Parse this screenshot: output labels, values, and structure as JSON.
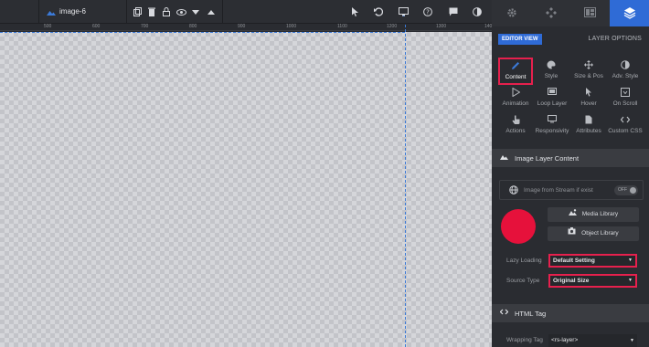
{
  "toolbar": {
    "layer_name": "image-6",
    "ruler_ticks": [
      "500",
      "600",
      "700",
      "800",
      "900",
      "1000",
      "1100",
      "1200",
      "1300",
      "1400"
    ]
  },
  "tabs": [
    {
      "icon": "gear-icon"
    },
    {
      "icon": "puzzle-icon"
    },
    {
      "icon": "media-icon"
    },
    {
      "icon": "layers-icon",
      "active": true
    }
  ],
  "panel": {
    "editor_view": "EDITOR VIEW",
    "layer_options": "LAYER OPTIONS",
    "options": [
      {
        "label": "Content",
        "icon": "pencil-icon",
        "active": true
      },
      {
        "label": "Style",
        "icon": "palette-icon"
      },
      {
        "label": "Size & Pos",
        "icon": "move-icon"
      },
      {
        "label": "Adv. Style",
        "icon": "contrast-icon"
      },
      {
        "label": "Animation",
        "icon": "play-icon"
      },
      {
        "label": "Loop Layer",
        "icon": "loop-icon"
      },
      {
        "label": "Hover",
        "icon": "hover-icon"
      },
      {
        "label": "On Scroll",
        "icon": "scroll-icon"
      },
      {
        "label": "Actions",
        "icon": "hand-icon"
      },
      {
        "label": "Responsivity",
        "icon": "monitor-icon"
      },
      {
        "label": "Attributes",
        "icon": "document-icon"
      },
      {
        "label": "Custom CSS",
        "icon": "code-icon"
      }
    ],
    "section_image": "Image Layer Content",
    "stream_label": "Image from Stream if exist",
    "stream_toggle": "OFF",
    "media_library": "Media Library",
    "object_library": "Object Library",
    "lazy_loading_label": "Lazy Loading",
    "lazy_loading_value": "Default Setting",
    "source_type_label": "Source Type",
    "source_type_value": "Original Size",
    "section_html": "HTML Tag",
    "wrapping_tag_label": "Wrapping Tag",
    "wrapping_tag_value": "<rs-layer>"
  },
  "colors": {
    "accent": "#2f6bd6",
    "highlight": "#e6204d",
    "image_preview": "#e6113b"
  }
}
